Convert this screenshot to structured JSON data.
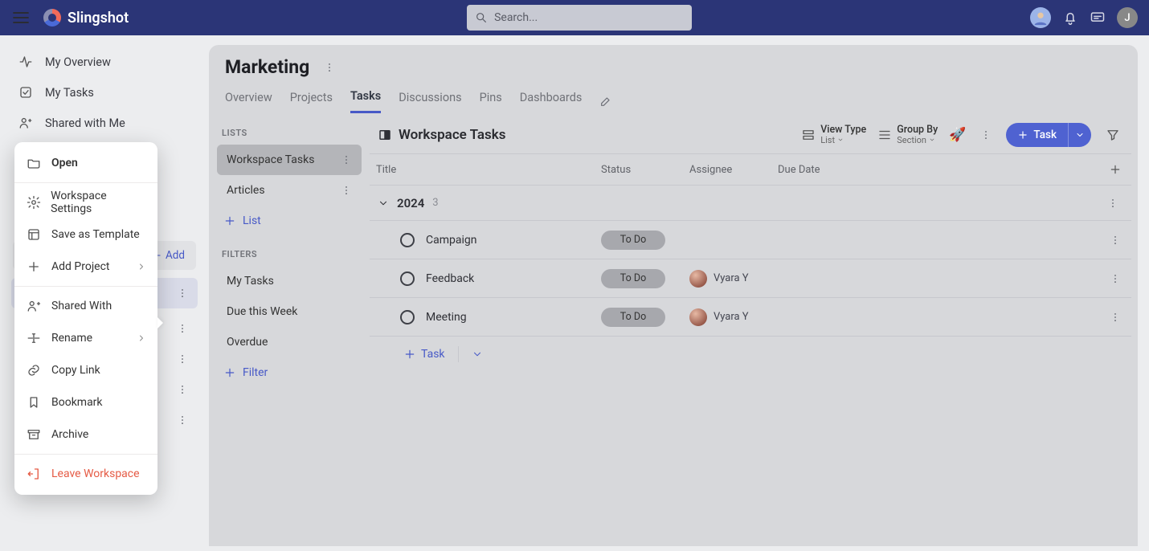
{
  "brand": "Slingshot",
  "search": {
    "placeholder": "Search..."
  },
  "topbar_user_initial": "J",
  "sidebar": {
    "items": [
      {
        "label": "My Overview"
      },
      {
        "label": "My Tasks"
      },
      {
        "label": "Shared with Me"
      }
    ],
    "add_label": "Add"
  },
  "context_menu": {
    "items": [
      {
        "label": "Open",
        "icon": "folder",
        "bold": true
      },
      {
        "label": "Workspace Settings",
        "icon": "gear"
      },
      {
        "label": "Save as Template",
        "icon": "template"
      },
      {
        "label": "Add Project",
        "icon": "plus",
        "chevron": true
      },
      {
        "label": "Shared With",
        "icon": "share"
      },
      {
        "label": "Rename",
        "icon": "rename",
        "chevron": true
      },
      {
        "label": "Copy Link",
        "icon": "link"
      },
      {
        "label": "Bookmark",
        "icon": "bookmark"
      },
      {
        "label": "Archive",
        "icon": "archive"
      },
      {
        "label": "Leave Workspace",
        "icon": "leave",
        "danger": true
      }
    ]
  },
  "page": {
    "title": "Marketing",
    "tabs": [
      "Overview",
      "Projects",
      "Tasks",
      "Discussions",
      "Pins",
      "Dashboards"
    ],
    "active_tab": "Tasks"
  },
  "lists_panel": {
    "section_label": "LISTS",
    "lists": [
      {
        "label": "Workspace Tasks",
        "selected": true
      },
      {
        "label": "Articles"
      }
    ],
    "add_list_label": "List",
    "filters_label": "FILTERS",
    "filters": [
      {
        "label": "My Tasks"
      },
      {
        "label": "Due this Week"
      },
      {
        "label": "Overdue"
      }
    ],
    "add_filter_label": "Filter"
  },
  "tasks_panel": {
    "title": "Workspace Tasks",
    "view_type": {
      "label": "View Type",
      "value": "List"
    },
    "group_by": {
      "label": "Group By",
      "value": "Section"
    },
    "task_button_label": "Task",
    "columns": [
      "Title",
      "Status",
      "Assignee",
      "Due Date"
    ],
    "group": {
      "label": "2024",
      "count": "3"
    },
    "rows": [
      {
        "title": "Campaign",
        "status": "To Do",
        "assignee": ""
      },
      {
        "title": "Feedback",
        "status": "To Do",
        "assignee": "Vyara Y"
      },
      {
        "title": "Meeting",
        "status": "To Do",
        "assignee": "Vyara Y"
      }
    ],
    "add_task_label": "Task"
  }
}
